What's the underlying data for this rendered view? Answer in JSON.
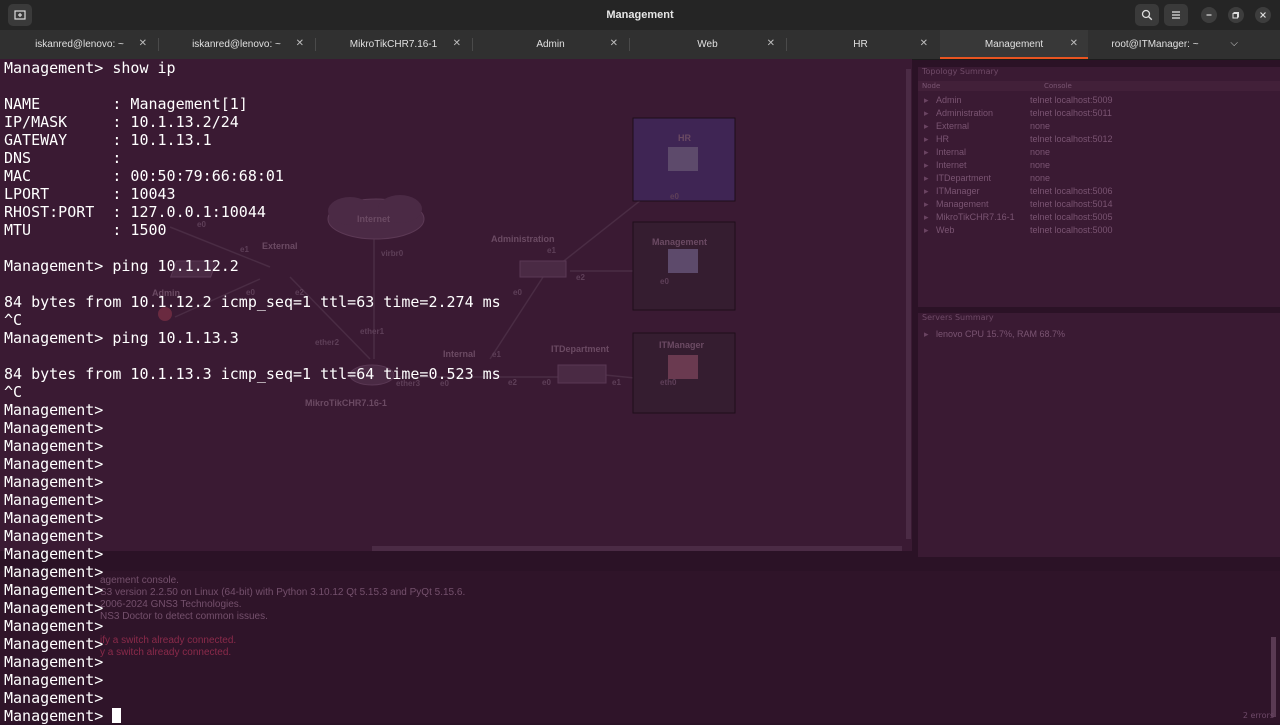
{
  "window": {
    "title": "Management"
  },
  "tabs": [
    {
      "label": "iskanred@lenovo: ~",
      "active": false
    },
    {
      "label": "iskanred@lenovo: ~",
      "active": false
    },
    {
      "label": "MikroTikCHR7.16-1",
      "active": false
    },
    {
      "label": "Admin",
      "active": false
    },
    {
      "label": "Web",
      "active": false
    },
    {
      "label": "HR",
      "active": false
    },
    {
      "label": "Management",
      "active": true
    },
    {
      "label": "root@ITManager: ~",
      "active": false
    }
  ],
  "colors": {
    "accent": "#e95420",
    "terminal_bg": "#2b1226",
    "terminal_fg": "#ffffff"
  },
  "terminal": {
    "lines": [
      "Management> show ip",
      "",
      "NAME        : Management[1]",
      "IP/MASK     : 10.1.13.2/24",
      "GATEWAY     : 10.1.13.1",
      "DNS         :",
      "MAC         : 00:50:79:66:68:01",
      "LPORT       : 10043",
      "RHOST:PORT  : 127.0.0.1:10044",
      "MTU         : 1500",
      "",
      "Management> ping 10.1.12.2",
      "",
      "84 bytes from 10.1.12.2 icmp_seq=1 ttl=63 time=2.274 ms",
      "^C",
      "Management> ping 10.1.13.3",
      "",
      "84 bytes from 10.1.13.3 icmp_seq=1 ttl=64 time=0.523 ms",
      "^C",
      "Management>",
      "Management>",
      "Management>",
      "Management>",
      "Management>",
      "Management>",
      "Management>",
      "Management>",
      "Management>",
      "Management>",
      "Management>",
      "Management>",
      "Management>",
      "Management>",
      "Management>",
      "Management>",
      "Management>",
      "Management>"
    ]
  },
  "background_app": {
    "topology": {
      "nodes": {
        "internet": "Internet",
        "external": "External",
        "admin": "Admin",
        "mikrotik": "MikroTikCHR7.16-1",
        "internal": "Internal",
        "administration": "Administration",
        "itdepartment": "ITDepartment",
        "hr": "HR",
        "management": "Management",
        "itmanager": "ITManager"
      },
      "ports": {
        "e0": "e0",
        "e1": "e1",
        "e2": "e2",
        "virbr0": "virbr0",
        "ether1": "ether1",
        "ether2": "ether2",
        "ether3": "ether3",
        "eth0": "eth0"
      }
    },
    "topology_summary": {
      "title": "Topology Summary",
      "columns": [
        "Node",
        "Console"
      ],
      "rows": [
        {
          "node": "Admin",
          "console": "telnet localhost:5009"
        },
        {
          "node": "Administration",
          "console": "telnet localhost:5011"
        },
        {
          "node": "External",
          "console": "none"
        },
        {
          "node": "HR",
          "console": "telnet localhost:5012"
        },
        {
          "node": "Internal",
          "console": "none"
        },
        {
          "node": "Internet",
          "console": "none"
        },
        {
          "node": "ITDepartment",
          "console": "none"
        },
        {
          "node": "ITManager",
          "console": "telnet localhost:5006"
        },
        {
          "node": "Management",
          "console": "telnet localhost:5014"
        },
        {
          "node": "MikroTikCHR7.16-1",
          "console": "telnet localhost:5005"
        },
        {
          "node": "Web",
          "console": "telnet localhost:5000"
        }
      ]
    },
    "servers_summary": {
      "title": "Servers Summary",
      "entry": "lenovo CPU 15.7%, RAM 68.7%"
    },
    "console_output": [
      {
        "text": "agement console.",
        "error": false
      },
      {
        "text": "S3 version 2.2.50 on Linux (64-bit) with Python 3.10.12 Qt 5.15.3 and PyQt 5.15.6.",
        "error": false
      },
      {
        "text": "2006-2024 GNS3 Technologies.",
        "error": false
      },
      {
        "text": "NS3 Doctor to detect common issues.",
        "error": false
      },
      {
        "text": "",
        "error": false
      },
      {
        "text": "ify a switch already connected.",
        "error": true
      },
      {
        "text": "y a switch already connected.",
        "error": true
      }
    ],
    "error_count": "2 errors"
  }
}
